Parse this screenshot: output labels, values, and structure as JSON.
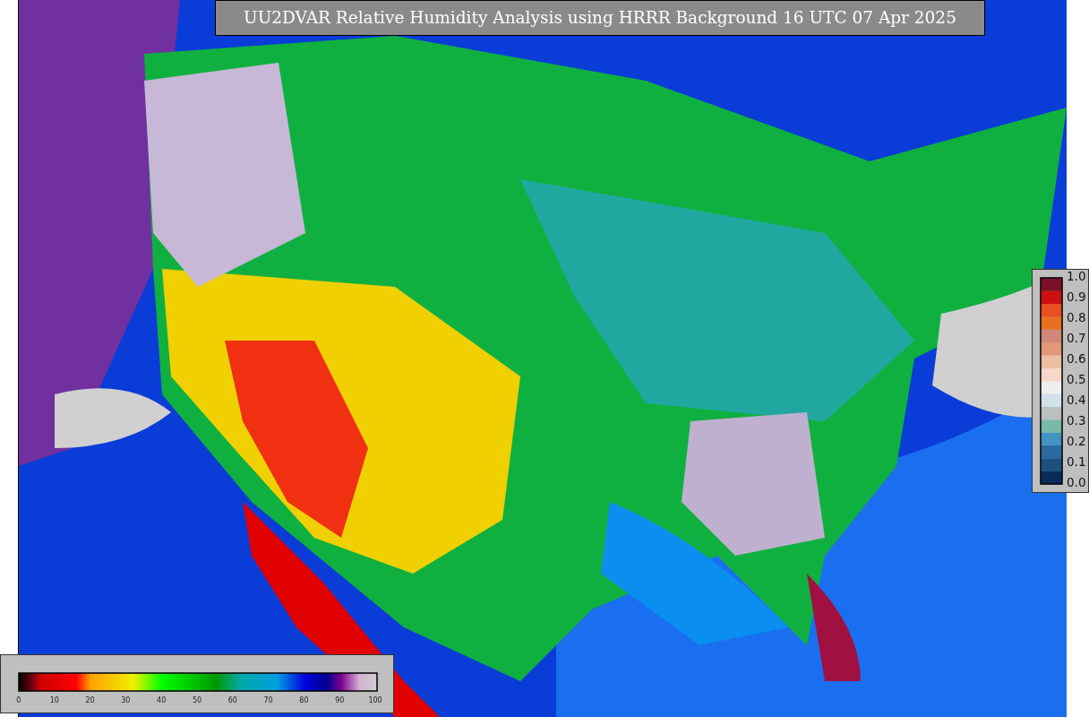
{
  "title": "UU2DVAR Relative Humidity Analysis using HRRR Background 16 UTC 07 Apr 2025",
  "side_legend": {
    "ticks": [
      "1.0",
      "0.9",
      "0.8",
      "0.7",
      "0.6",
      "0.5",
      "0.4",
      "0.3",
      "0.2",
      "0.1",
      "0.0"
    ]
  },
  "bottom_legend": {
    "ticks": [
      "0",
      "10",
      "20",
      "30",
      "40",
      "50",
      "60",
      "70",
      "80",
      "90",
      "100"
    ]
  }
}
